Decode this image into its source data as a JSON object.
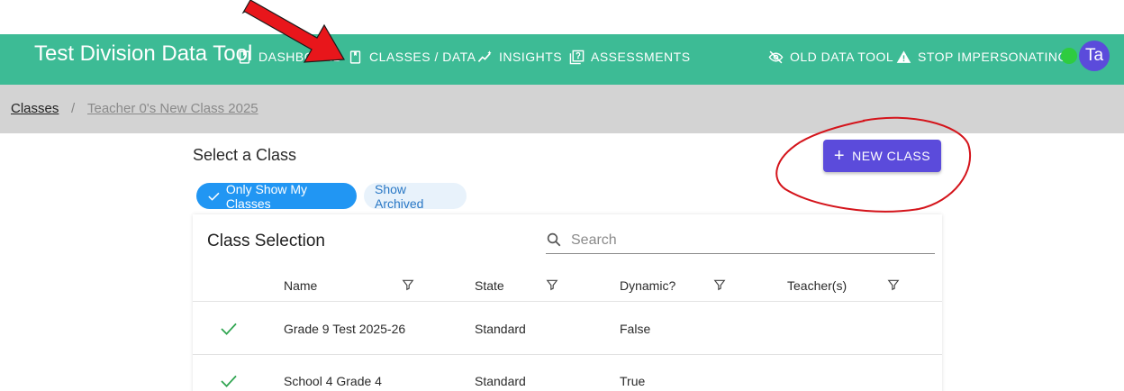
{
  "header": {
    "app_title": "Test Division Data Tool",
    "nav": [
      {
        "label": "DASHBOARD",
        "icon": "notebook-icon"
      },
      {
        "label": "CLASSES / DATA",
        "icon": "notebook-icon"
      },
      {
        "label": "INSIGHTS",
        "icon": "insights-icon"
      },
      {
        "label": "ASSESSMENTS",
        "icon": "assessment-icon"
      }
    ],
    "right_nav": [
      {
        "label": "OLD DATA TOOL",
        "icon": "hide-icon"
      },
      {
        "label": "STOP IMPERSONATING",
        "icon": "warning-icon"
      }
    ],
    "avatar": "Ta",
    "bar_color": "#3dbb95",
    "status_color": "#2ecc40"
  },
  "breadcrumb": {
    "root": "Classes",
    "separator": "/",
    "current": "Teacher 0's New Class 2025"
  },
  "main": {
    "title": "Select a Class",
    "new_class_label": "NEW CLASS",
    "chips": {
      "only_mine": "Only Show My Classes",
      "show_archived": "Show Archived"
    },
    "accent": "#5b4bdb"
  },
  "table": {
    "title": "Class Selection",
    "search_placeholder": "Search",
    "columns": [
      "Name",
      "State",
      "Dynamic?",
      "Teacher(s)"
    ],
    "rows": [
      {
        "selected": true,
        "name": "Grade 9 Test 2025-26",
        "state": "Standard",
        "dynamic": "False",
        "teachers": ""
      },
      {
        "selected": true,
        "name": "School 4 Grade 4",
        "state": "Standard",
        "dynamic": "True",
        "teachers": ""
      }
    ]
  }
}
